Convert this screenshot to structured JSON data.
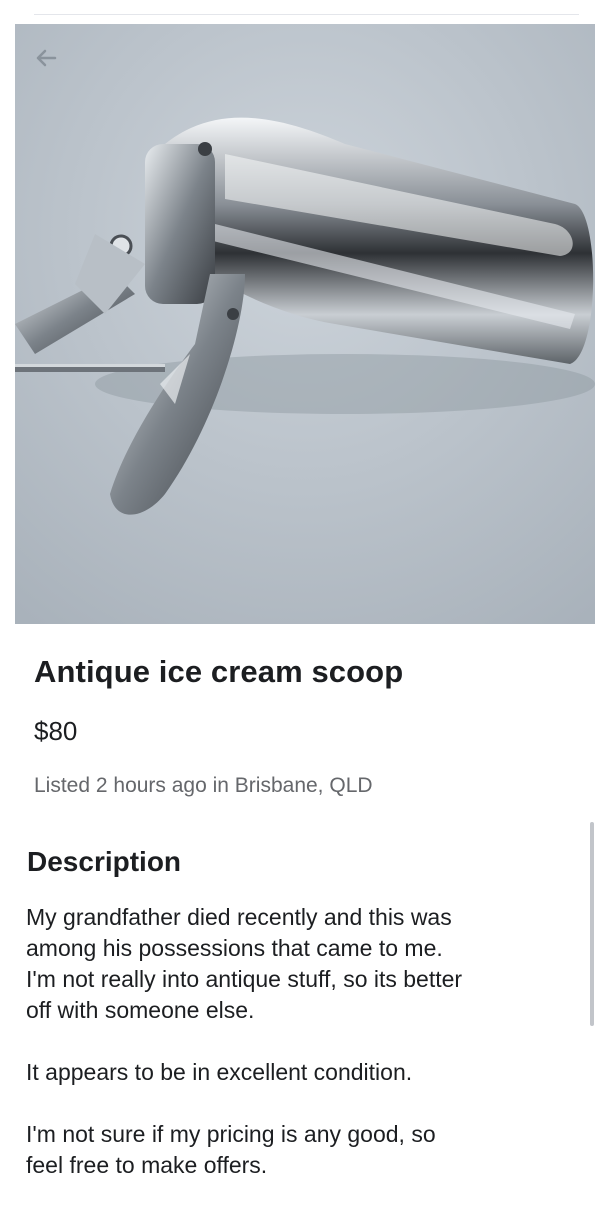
{
  "listing": {
    "title": "Antique ice cream scoop",
    "price": "$80",
    "meta": "Listed 2 hours ago in Brisbane, QLD",
    "description_heading": "Description",
    "description_paragraphs": [
      "My grandfather died recently and this was\namong his possessions that came to me.\nI'm not really into antique stuff, so its better\noff with someone else.",
      "It appears to be in excellent condition.",
      "I'm not sure if my pricing is any good, so\nfeel free to make offers."
    ]
  },
  "icons": {
    "back": "arrow-left-icon"
  },
  "colors": {
    "text": "#1c1e21",
    "secondary_text": "#65676b",
    "photo_background": "#b9c1c9"
  }
}
